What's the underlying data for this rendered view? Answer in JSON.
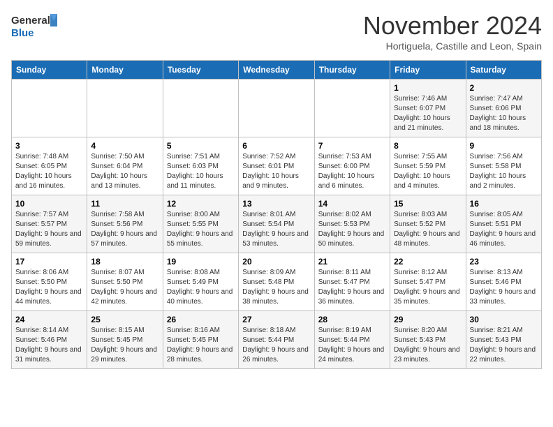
{
  "logo": {
    "line1": "General",
    "line2": "Blue"
  },
  "title": "November 2024",
  "subtitle": "Hortiguela, Castille and Leon, Spain",
  "weekdays": [
    "Sunday",
    "Monday",
    "Tuesday",
    "Wednesday",
    "Thursday",
    "Friday",
    "Saturday"
  ],
  "weeks": [
    [
      {
        "day": "",
        "info": ""
      },
      {
        "day": "",
        "info": ""
      },
      {
        "day": "",
        "info": ""
      },
      {
        "day": "",
        "info": ""
      },
      {
        "day": "",
        "info": ""
      },
      {
        "day": "1",
        "info": "Sunrise: 7:46 AM\nSunset: 6:07 PM\nDaylight: 10 hours and 21 minutes."
      },
      {
        "day": "2",
        "info": "Sunrise: 7:47 AM\nSunset: 6:06 PM\nDaylight: 10 hours and 18 minutes."
      }
    ],
    [
      {
        "day": "3",
        "info": "Sunrise: 7:48 AM\nSunset: 6:05 PM\nDaylight: 10 hours and 16 minutes."
      },
      {
        "day": "4",
        "info": "Sunrise: 7:50 AM\nSunset: 6:04 PM\nDaylight: 10 hours and 13 minutes."
      },
      {
        "day": "5",
        "info": "Sunrise: 7:51 AM\nSunset: 6:03 PM\nDaylight: 10 hours and 11 minutes."
      },
      {
        "day": "6",
        "info": "Sunrise: 7:52 AM\nSunset: 6:01 PM\nDaylight: 10 hours and 9 minutes."
      },
      {
        "day": "7",
        "info": "Sunrise: 7:53 AM\nSunset: 6:00 PM\nDaylight: 10 hours and 6 minutes."
      },
      {
        "day": "8",
        "info": "Sunrise: 7:55 AM\nSunset: 5:59 PM\nDaylight: 10 hours and 4 minutes."
      },
      {
        "day": "9",
        "info": "Sunrise: 7:56 AM\nSunset: 5:58 PM\nDaylight: 10 hours and 2 minutes."
      }
    ],
    [
      {
        "day": "10",
        "info": "Sunrise: 7:57 AM\nSunset: 5:57 PM\nDaylight: 9 hours and 59 minutes."
      },
      {
        "day": "11",
        "info": "Sunrise: 7:58 AM\nSunset: 5:56 PM\nDaylight: 9 hours and 57 minutes."
      },
      {
        "day": "12",
        "info": "Sunrise: 8:00 AM\nSunset: 5:55 PM\nDaylight: 9 hours and 55 minutes."
      },
      {
        "day": "13",
        "info": "Sunrise: 8:01 AM\nSunset: 5:54 PM\nDaylight: 9 hours and 53 minutes."
      },
      {
        "day": "14",
        "info": "Sunrise: 8:02 AM\nSunset: 5:53 PM\nDaylight: 9 hours and 50 minutes."
      },
      {
        "day": "15",
        "info": "Sunrise: 8:03 AM\nSunset: 5:52 PM\nDaylight: 9 hours and 48 minutes."
      },
      {
        "day": "16",
        "info": "Sunrise: 8:05 AM\nSunset: 5:51 PM\nDaylight: 9 hours and 46 minutes."
      }
    ],
    [
      {
        "day": "17",
        "info": "Sunrise: 8:06 AM\nSunset: 5:50 PM\nDaylight: 9 hours and 44 minutes."
      },
      {
        "day": "18",
        "info": "Sunrise: 8:07 AM\nSunset: 5:50 PM\nDaylight: 9 hours and 42 minutes."
      },
      {
        "day": "19",
        "info": "Sunrise: 8:08 AM\nSunset: 5:49 PM\nDaylight: 9 hours and 40 minutes."
      },
      {
        "day": "20",
        "info": "Sunrise: 8:09 AM\nSunset: 5:48 PM\nDaylight: 9 hours and 38 minutes."
      },
      {
        "day": "21",
        "info": "Sunrise: 8:11 AM\nSunset: 5:47 PM\nDaylight: 9 hours and 36 minutes."
      },
      {
        "day": "22",
        "info": "Sunrise: 8:12 AM\nSunset: 5:47 PM\nDaylight: 9 hours and 35 minutes."
      },
      {
        "day": "23",
        "info": "Sunrise: 8:13 AM\nSunset: 5:46 PM\nDaylight: 9 hours and 33 minutes."
      }
    ],
    [
      {
        "day": "24",
        "info": "Sunrise: 8:14 AM\nSunset: 5:46 PM\nDaylight: 9 hours and 31 minutes."
      },
      {
        "day": "25",
        "info": "Sunrise: 8:15 AM\nSunset: 5:45 PM\nDaylight: 9 hours and 29 minutes."
      },
      {
        "day": "26",
        "info": "Sunrise: 8:16 AM\nSunset: 5:45 PM\nDaylight: 9 hours and 28 minutes."
      },
      {
        "day": "27",
        "info": "Sunrise: 8:18 AM\nSunset: 5:44 PM\nDaylight: 9 hours and 26 minutes."
      },
      {
        "day": "28",
        "info": "Sunrise: 8:19 AM\nSunset: 5:44 PM\nDaylight: 9 hours and 24 minutes."
      },
      {
        "day": "29",
        "info": "Sunrise: 8:20 AM\nSunset: 5:43 PM\nDaylight: 9 hours and 23 minutes."
      },
      {
        "day": "30",
        "info": "Sunrise: 8:21 AM\nSunset: 5:43 PM\nDaylight: 9 hours and 22 minutes."
      }
    ]
  ]
}
